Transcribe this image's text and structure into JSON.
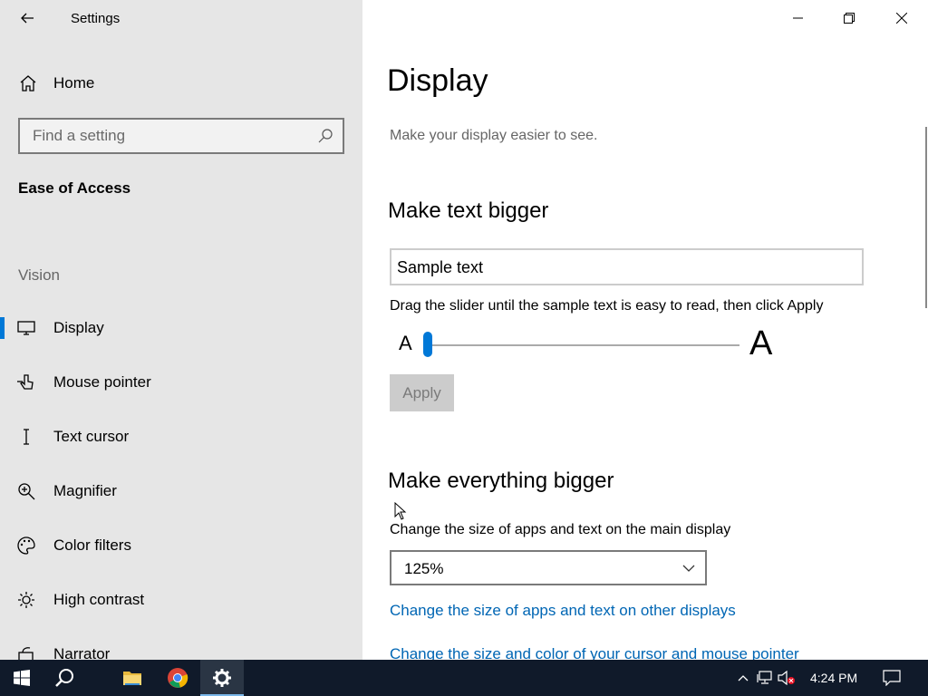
{
  "window": {
    "app_title": "Settings",
    "back_label": "Back",
    "minimize_label": "Minimize",
    "restore_label": "Restore",
    "close_label": "Close"
  },
  "sidebar": {
    "home_label": "Home",
    "search_placeholder": "Find a setting",
    "section_title": "Ease of Access",
    "group_label": "Vision",
    "items": [
      {
        "label": "Display",
        "icon": "monitor-icon",
        "selected": true
      },
      {
        "label": "Mouse pointer",
        "icon": "mouse-pointer-icon",
        "selected": false
      },
      {
        "label": "Text cursor",
        "icon": "text-cursor-icon",
        "selected": false
      },
      {
        "label": "Magnifier",
        "icon": "magnifier-icon",
        "selected": false
      },
      {
        "label": "Color filters",
        "icon": "color-filters-icon",
        "selected": false
      },
      {
        "label": "High contrast",
        "icon": "high-contrast-icon",
        "selected": false
      },
      {
        "label": "Narrator",
        "icon": "narrator-icon",
        "selected": false
      }
    ]
  },
  "main": {
    "title": "Display",
    "subtitle": "Make your display easier to see.",
    "text_bigger": {
      "heading": "Make text bigger",
      "sample_text": "Sample text",
      "instruction": "Drag the slider until the sample text is easy to read, then click Apply",
      "slider_min_label": "A",
      "slider_max_label": "A",
      "slider_value_percent": 0,
      "apply_label": "Apply"
    },
    "everything_bigger": {
      "heading": "Make everything bigger",
      "scale_label": "Change the size of apps and text on the main display",
      "scale_value": "125%",
      "link_other_displays": "Change the size of apps and text on other displays",
      "link_cursor": "Change the size and color of your cursor and mouse pointer"
    }
  },
  "taskbar": {
    "time": "4:24 PM",
    "apps": [
      "start-icon",
      "search-icon",
      "file-explorer-icon",
      "chrome-icon",
      "settings-icon"
    ]
  },
  "colors": {
    "accent": "#0078d7",
    "link": "#0066b4",
    "sidebar_bg": "#e6e6e6",
    "taskbar_bg": "#101a2a"
  }
}
